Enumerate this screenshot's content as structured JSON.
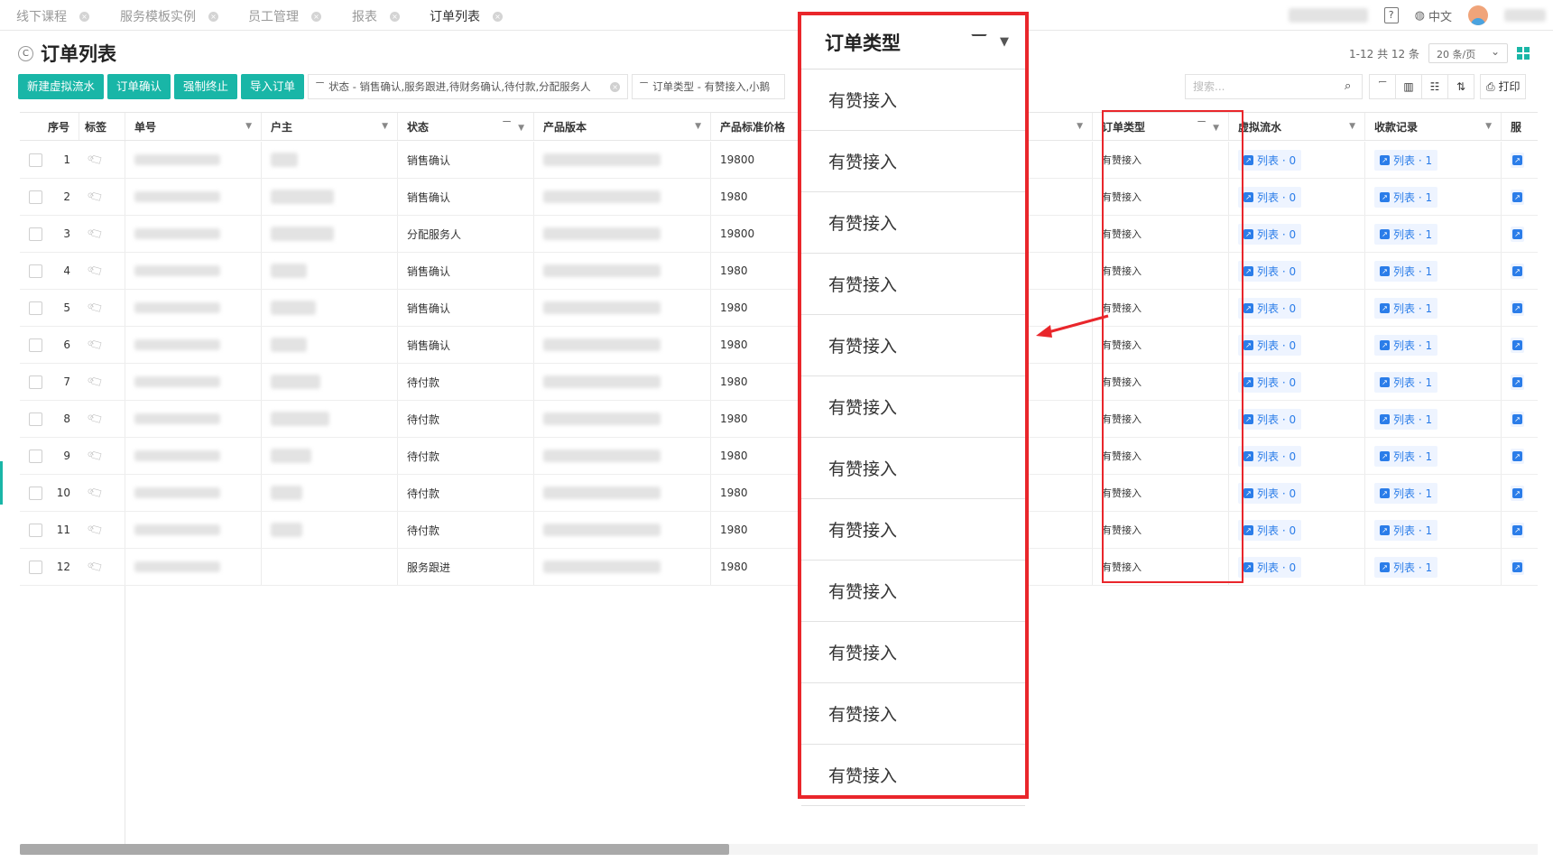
{
  "tabs": [
    {
      "label": "线下课程"
    },
    {
      "label": "服务模板实例"
    },
    {
      "label": "员工管理"
    },
    {
      "label": "报表"
    },
    {
      "label": "订单列表"
    }
  ],
  "header": {
    "lang": "中文"
  },
  "page": {
    "title": "订单列表"
  },
  "pager": {
    "summary": "1-12 共 12 条",
    "page_size": "20 条/页"
  },
  "toolbar": {
    "buttons": [
      "新建虚拟流水",
      "订单确认",
      "强制终止",
      "导入订单"
    ],
    "filter_status": "状态 - 销售确认,服务跟进,待财务确认,待付款,分配服务人",
    "filter_type": "订单类型 - 有赞接入,小鹅"
  },
  "search": {
    "placeholder": "搜索..."
  },
  "tools": {
    "print": "打印"
  },
  "table": {
    "headers": {
      "seq": "序号",
      "tag": "标签",
      "order_no": "单号",
      "owner": "户主",
      "status": "状态",
      "product": "产品版本",
      "price": "产品标准价格",
      "order_type": "订单类型",
      "virtual_flow": "虚拟流水",
      "payment": "收款记录",
      "service": "服"
    },
    "rows": [
      {
        "seq": "1",
        "status": "销售确认",
        "price": "19800",
        "order_type": "有赞接入",
        "vf": "列表 · 0",
        "pay": "列表 · 1"
      },
      {
        "seq": "2",
        "status": "销售确认",
        "price": "1980",
        "order_type": "有赞接入",
        "vf": "列表 · 0",
        "pay": "列表 · 1"
      },
      {
        "seq": "3",
        "status": "分配服务人",
        "price": "19800",
        "order_type": "有赞接入",
        "vf": "列表 · 0",
        "pay": "列表 · 1"
      },
      {
        "seq": "4",
        "status": "销售确认",
        "price": "1980",
        "order_type": "有赞接入",
        "vf": "列表 · 0",
        "pay": "列表 · 1"
      },
      {
        "seq": "5",
        "status": "销售确认",
        "price": "1980",
        "order_type": "有赞接入",
        "vf": "列表 · 0",
        "pay": "列表 · 1"
      },
      {
        "seq": "6",
        "status": "销售确认",
        "price": "1980",
        "order_type": "有赞接入",
        "vf": "列表 · 0",
        "pay": "列表 · 1"
      },
      {
        "seq": "7",
        "status": "待付款",
        "price": "1980",
        "order_type": "有赞接入",
        "vf": "列表 · 0",
        "pay": "列表 · 1"
      },
      {
        "seq": "8",
        "status": "待付款",
        "price": "1980",
        "order_type": "有赞接入",
        "vf": "列表 · 0",
        "pay": "列表 · 1"
      },
      {
        "seq": "9",
        "status": "待付款",
        "price": "1980",
        "order_type": "有赞接入",
        "vf": "列表 · 0",
        "pay": "列表 · 1"
      },
      {
        "seq": "10",
        "status": "待付款",
        "price": "1980",
        "order_type": "有赞接入",
        "vf": "列表 · 0",
        "pay": "列表 · 1"
      },
      {
        "seq": "11",
        "status": "待付款",
        "price": "1980",
        "order_type": "有赞接入",
        "vf": "列表 · 0",
        "pay": "列表 · 1"
      },
      {
        "seq": "12",
        "status": "服务跟进",
        "price": "1980",
        "order_type": "有赞接入",
        "vf": "列表 · 0",
        "pay": "列表 · 1"
      }
    ]
  },
  "popup": {
    "header": "订单类型",
    "items": [
      "有赞接入",
      "有赞接入",
      "有赞接入",
      "有赞接入",
      "有赞接入",
      "有赞接入",
      "有赞接入",
      "有赞接入",
      "有赞接入",
      "有赞接入",
      "有赞接入",
      "有赞接入"
    ]
  },
  "colors": {
    "accent": "#19b6a7",
    "highlight": "#e9262b",
    "link": "#2b7de9"
  }
}
